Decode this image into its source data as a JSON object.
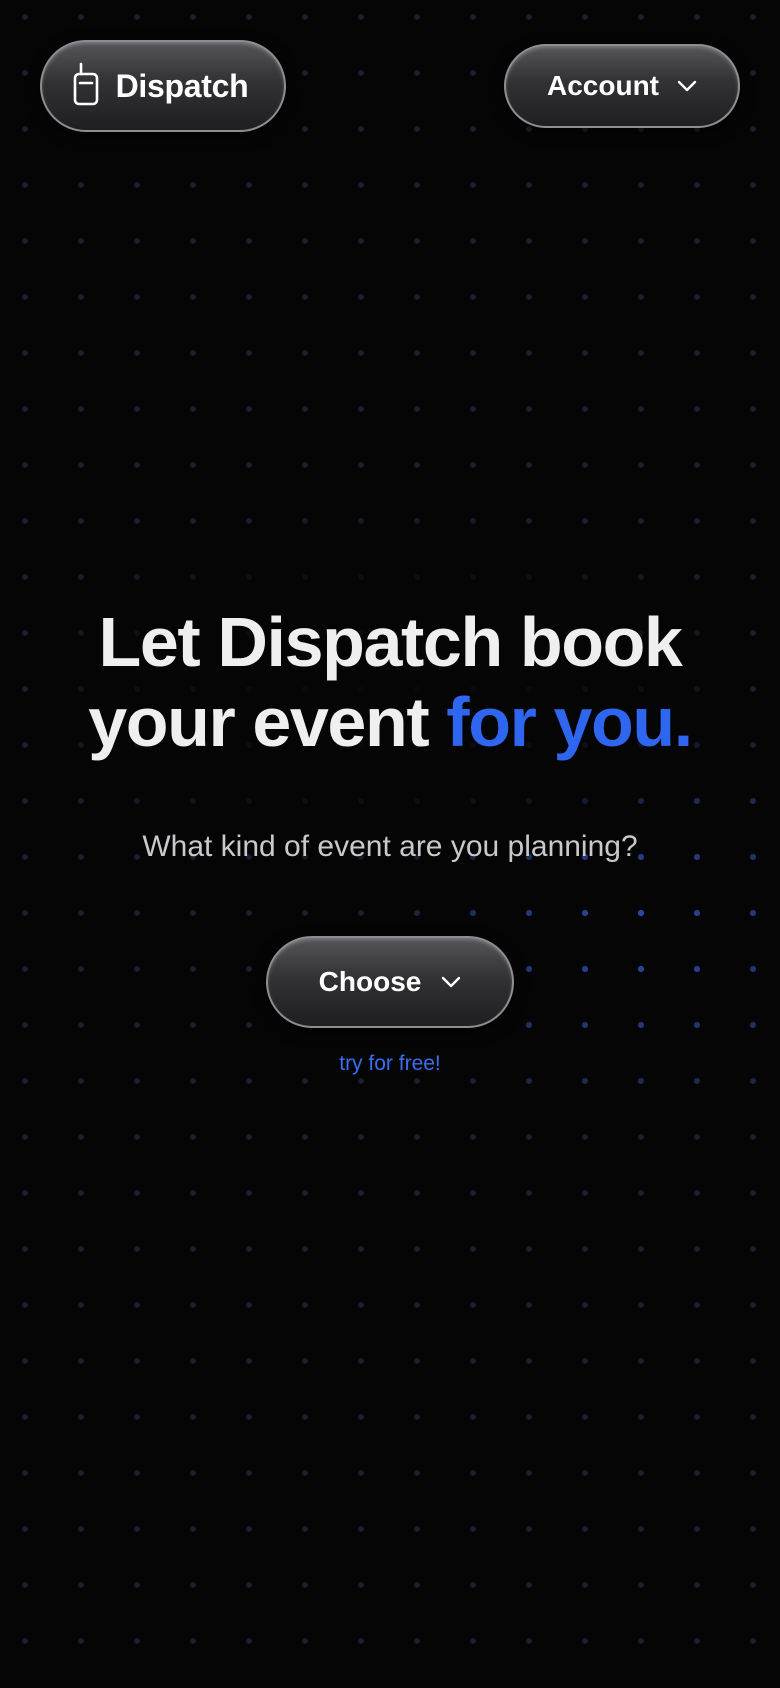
{
  "header": {
    "brand_name": "Dispatch",
    "brand_icon": "walkie-talkie-icon",
    "account_label": "Account",
    "account_icon": "chevron-down-icon"
  },
  "hero": {
    "title_line1": "Let Dispatch book",
    "title_line2_prefix": "your event ",
    "title_line2_accent": "for you.",
    "subtitle": "What kind of event are you planning?",
    "choose_label": "Choose",
    "choose_icon": "chevron-down-icon",
    "free_link": "try for free!"
  },
  "colors": {
    "background": "#050506",
    "accent": "#2f66f0",
    "text": "#efefef",
    "muted_text": "#c9c9cc",
    "pill_border": "#8e8e92"
  }
}
